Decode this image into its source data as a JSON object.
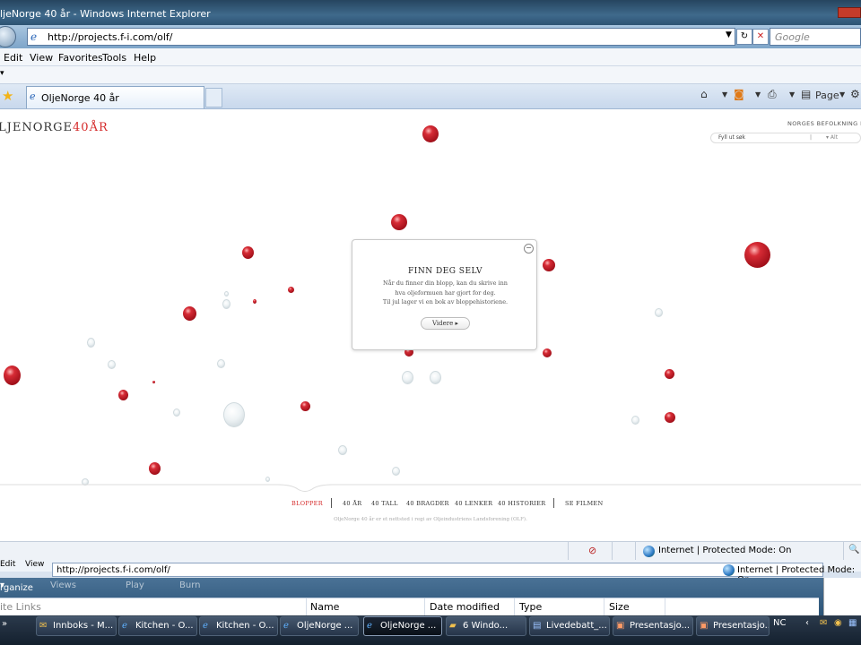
{
  "window": {
    "title": "ljeNorge 40 år - Windows Internet Explorer",
    "address": "http://projects.f-i.com/olf/",
    "search_placeholder": "Google"
  },
  "menu": [
    "Edit",
    "View",
    "Favorites",
    "Tools",
    "Help"
  ],
  "tab": {
    "label": "OljeNorge 40 år"
  },
  "toolbar": {
    "page_label": "Page"
  },
  "page": {
    "logo_main": "LJENORGE",
    "logo_accent": "40ÅR",
    "header_right": "NORGES BEFOLKNING IDAG",
    "search_placeholder": "Fyll ut søk",
    "search_option": "Alt",
    "popup": {
      "title": "FINN DEG SELV",
      "line1": "Når du finner din blopp, kan du skrive inn",
      "line2": "hva oljeformuen har gjort for deg.",
      "line3": "Til jul lager vi en bok av bloppehistoriene.",
      "button": "Videre"
    },
    "nav": [
      "BLOPPER",
      "40 ÅR",
      "40 TALL",
      "40 BRAGDER",
      "40 LENKER",
      "40 HISTORIER",
      "SE FILMEN"
    ],
    "footer": "OljeNorge 40 år er et nettsted i regi av Oljeindustriens Landsforening (OLF)."
  },
  "status": {
    "zone": "Internet | Protected Mode: On"
  },
  "window2": {
    "menu": [
      "Edit",
      "View"
    ],
    "address": "http://projects.f-i.com/olf/",
    "zone": "Internet | Protected Mode: On",
    "org": [
      "rganize",
      "Views",
      "Play",
      "Burn"
    ],
    "columns": [
      "Name",
      "Date modified",
      "Type",
      "Size"
    ],
    "left_link": "ite Links"
  },
  "taskbar": {
    "items": [
      "Innboks - M...",
      "Kitchen - O...",
      "Kitchen - O...",
      "OljeNorge ...",
      "OljeNorge ...",
      "6 Windo...",
      "Livedebatt_...",
      "Presentasjo...",
      "Presentasjo..."
    ],
    "lang": "NC"
  },
  "colors": {
    "accent": "#d52b2b",
    "chrome": "#3f6a8c"
  }
}
